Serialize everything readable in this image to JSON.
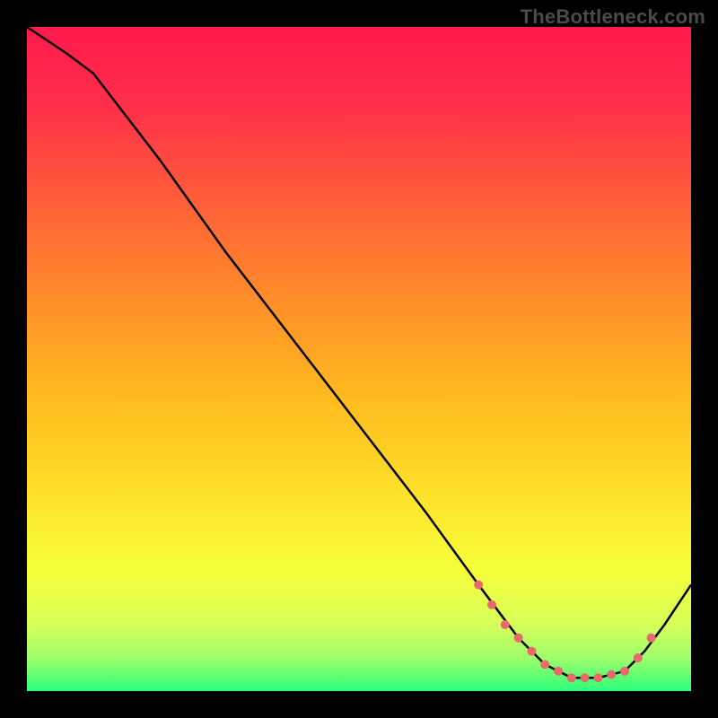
{
  "watermark": "TheBottleneck.com",
  "chart_data": {
    "type": "line",
    "title": "",
    "xlabel": "",
    "ylabel": "",
    "xlim": [
      0,
      100
    ],
    "ylim": [
      0,
      100
    ],
    "curve": {
      "x": [
        0,
        6,
        10,
        20,
        30,
        40,
        50,
        60,
        68,
        74,
        78,
        82,
        86,
        90,
        93,
        96,
        100
      ],
      "y": [
        100,
        96,
        93,
        80,
        66,
        53,
        40,
        27,
        16,
        8,
        4,
        2,
        2,
        3,
        6,
        10,
        16
      ]
    },
    "markers": {
      "x": [
        68,
        70,
        72,
        74,
        76,
        78,
        80,
        82,
        84,
        86,
        88,
        90,
        92,
        94
      ],
      "y": [
        16,
        13,
        10,
        8,
        6,
        4,
        3,
        2,
        2,
        2,
        2.5,
        3,
        5,
        8
      ]
    },
    "gradient_stops": [
      {
        "offset": 0.0,
        "color": "#ff1a4d"
      },
      {
        "offset": 0.12,
        "color": "#ff2f4a"
      },
      {
        "offset": 0.25,
        "color": "#ff5a3a"
      },
      {
        "offset": 0.4,
        "color": "#ff8a2a"
      },
      {
        "offset": 0.55,
        "color": "#ffb81f"
      },
      {
        "offset": 0.7,
        "color": "#ffe02a"
      },
      {
        "offset": 0.82,
        "color": "#f6ff3a"
      },
      {
        "offset": 0.9,
        "color": "#d6ff5a"
      },
      {
        "offset": 0.95,
        "color": "#9eff6a"
      },
      {
        "offset": 1.0,
        "color": "#2bff7a"
      }
    ],
    "marker_color": "#e86a6a",
    "line_color": "#000000"
  }
}
